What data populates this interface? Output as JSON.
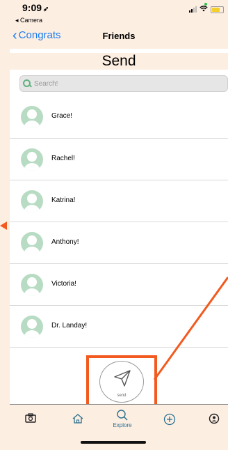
{
  "status": {
    "time": "9:09",
    "back_app": "◂ Camera"
  },
  "nav": {
    "back_label": "Congrats",
    "title": "Friends"
  },
  "page": {
    "title": "Send"
  },
  "search": {
    "placeholder": "Search!"
  },
  "friends": [
    {
      "name": "Grace!"
    },
    {
      "name": "Rachel!"
    },
    {
      "name": "Katrina!"
    },
    {
      "name": "Anthony!"
    },
    {
      "name": "Victoria!"
    },
    {
      "name": "Dr. Landay!"
    }
  ],
  "send": {
    "label": "send"
  },
  "tabbar": {
    "items": [
      {
        "icon": "camera-icon",
        "label": ""
      },
      {
        "icon": "home-icon",
        "label": ""
      },
      {
        "icon": "search-icon",
        "label": "Explore"
      },
      {
        "icon": "add-icon",
        "label": ""
      },
      {
        "icon": "profile-icon",
        "label": ""
      }
    ]
  },
  "colors": {
    "accent": "#1a7cf0",
    "highlight": "#f25a1f",
    "avatar": "#b8dcc3",
    "background": "#fdeee2"
  }
}
